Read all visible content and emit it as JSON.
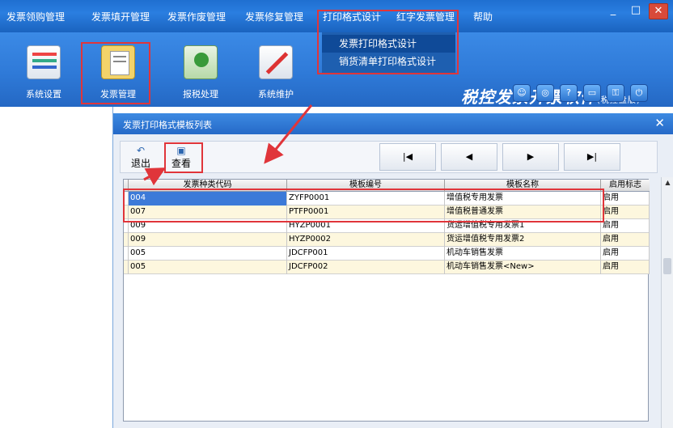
{
  "menu": {
    "items": [
      "发票领购管理",
      "发票填开管理",
      "发票作废管理",
      "发票修复管理",
      "打印格式设计",
      "红字发票管理",
      "帮助"
    ]
  },
  "window_controls": {
    "minimize": "_",
    "maximize": "□",
    "close": "✕"
  },
  "dropdown": {
    "items": [
      "发票打印格式设计",
      "销货清单打印格式设计"
    ]
  },
  "toolbar": {
    "items": [
      {
        "label": "系统设置",
        "icon": "settings-icon"
      },
      {
        "label": "发票管理",
        "icon": "invoice-management-icon"
      },
      {
        "label": "报税处理",
        "icon": "tax-report-icon"
      },
      {
        "label": "系统维护",
        "icon": "maintenance-icon"
      }
    ]
  },
  "brand": {
    "title": "税控发票开票软件",
    "subtitle": "(税控盘版)"
  },
  "brand_icons": [
    "user-icon",
    "globe-icon",
    "help-icon",
    "window-icon",
    "key-icon",
    "power-icon"
  ],
  "dialog": {
    "title": "发票打印格式模板列表",
    "close": "✕",
    "toolbar": {
      "exit_label": "退出",
      "view_label": "查看",
      "nav_first": "|◀",
      "nav_prev": "◀",
      "nav_next": "▶",
      "nav_last": "▶|"
    }
  },
  "grid": {
    "columns": [
      "发票种类代码",
      "模板编号",
      "模板名称",
      "启用标志"
    ],
    "rows": [
      [
        "004",
        "ZYFP0001",
        "增值税专用发票",
        "启用"
      ],
      [
        "007",
        "PTFP0001",
        "增值税普通发票",
        "启用"
      ],
      [
        "009",
        "HYZP0001",
        "货运增值税专用发票1",
        "启用"
      ],
      [
        "009",
        "HYZP0002",
        "货运增值税专用发票2",
        "启用"
      ],
      [
        "005",
        "JDCFP001",
        "机动车销售发票",
        "启用"
      ],
      [
        "005",
        "JDCFP002",
        "机动车销售发票<New>",
        "启用"
      ]
    ]
  },
  "colors": {
    "menubar": "#1f6fd0",
    "annotation_red": "#e0353a",
    "selection": "#3c7ad8",
    "alt_row": "#fdf7de"
  }
}
